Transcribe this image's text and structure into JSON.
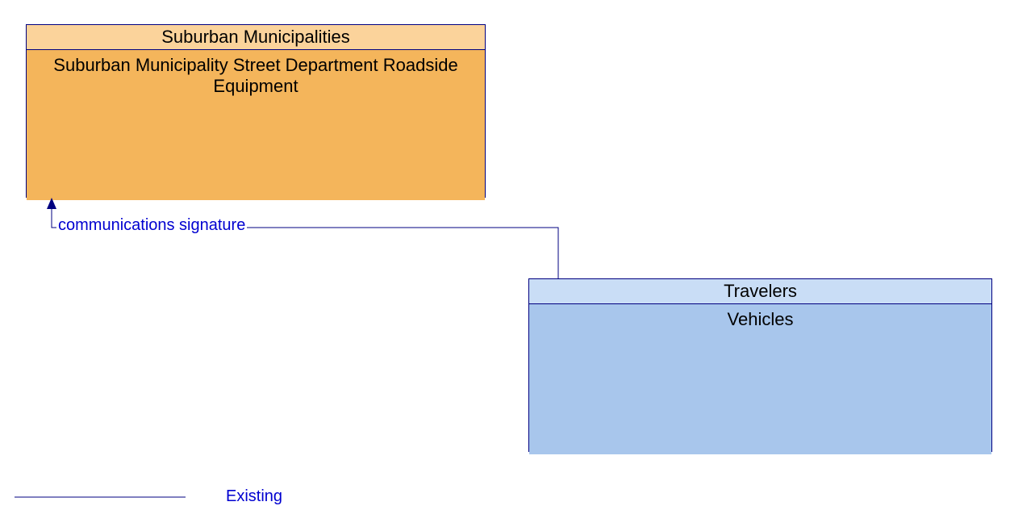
{
  "boxes": {
    "suburban": {
      "header": "Suburban Municipalities",
      "body": "Suburban Municipality Street Department Roadside Equipment"
    },
    "travelers": {
      "header": "Travelers",
      "body": "Vehicles"
    }
  },
  "flow": {
    "label": "communications signature"
  },
  "legend": {
    "label": "Existing"
  },
  "colors": {
    "line": "#000080",
    "text_link": "#0000d0",
    "orange_header": "#fbd39b",
    "orange_body": "#f4b55b",
    "blue_header": "#c9ddf6",
    "blue_body": "#a8c6ec"
  }
}
